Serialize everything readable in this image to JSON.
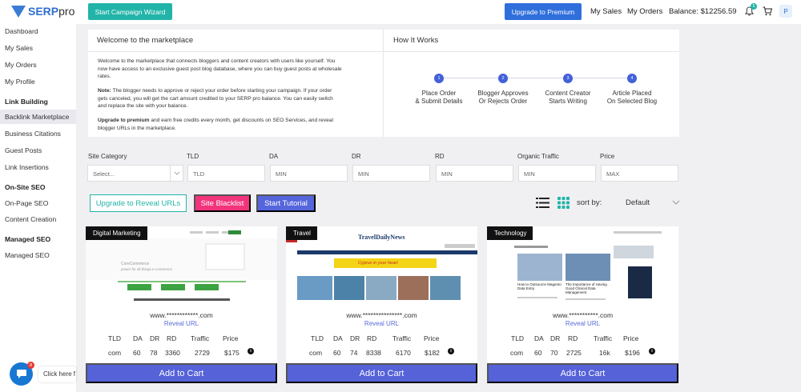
{
  "header": {
    "logo_prefix": "SERP",
    "logo_suffix": "pro",
    "wizard_label": "Start Campaign Wizard",
    "upgrade_label": "Upgrade to Premium",
    "my_sales": "My Sales",
    "my_orders": "My Orders",
    "balance": "Balance: $12256.59",
    "notification_count": "5",
    "avatar_initial": "P",
    "accent_color": "#22b4a8",
    "primary_color": "#2f6fdc"
  },
  "sidebar": {
    "items": [
      "Dashboard",
      "My Sales",
      "My Orders",
      "My Profile"
    ],
    "link_building_heading": "Link Building",
    "link_building_items": [
      "Backlink Marketplace",
      "Business Citations",
      "Guest Posts",
      "Link Insertions"
    ],
    "onsite_heading": "On-Site SEO",
    "onsite_items": [
      "On-Page SEO",
      "Content Creation"
    ],
    "managed_heading": "Managed SEO",
    "managed_items": [
      "Managed SEO"
    ],
    "active_item": "Backlink Marketplace"
  },
  "welcome": {
    "title": "Welcome to the marketplace",
    "intro": "Welcome to the marketplace that connects bloggers and content creators with users like yourself. You now have access to an exclusive guest post blog database, where you can buy guest posts at wholesale rates.",
    "note_label": "Note:",
    "note_text": " The blogger needs to approve or reject your order before starting your campaign. If your order gets canceled, you will get the cart amount credited to your SERP pro balance. You can easily switch and replace the site with your balance.",
    "premium_label": "Upgrade to premium",
    "premium_text": " and earn free credits every month, get discounts on SEO Services, and reveal blogger URLs in the marketplace."
  },
  "how_it_works": {
    "title": "How It Works",
    "steps": [
      {
        "num": "1",
        "line1": "Place Order",
        "line2": "& Submit Details"
      },
      {
        "num": "2",
        "line1": "Blogger Approves",
        "line2": "Or Rejects Order"
      },
      {
        "num": "3",
        "line1": "Content Creator",
        "line2": "Starts Writing"
      },
      {
        "num": "4",
        "line1": "Article Placed",
        "line2": "On Selected Blog"
      }
    ]
  },
  "filters": {
    "site_category": {
      "label": "Site Category",
      "placeholder": "Select..."
    },
    "tld": {
      "label": "TLD",
      "placeholder": "TLD"
    },
    "da": {
      "label": "DA",
      "placeholder": "MIN"
    },
    "dr": {
      "label": "DR",
      "placeholder": "MIN"
    },
    "rd": {
      "label": "RD",
      "placeholder": "MIN"
    },
    "traffic": {
      "label": "Organic Traffic",
      "placeholder": "MIN"
    },
    "price": {
      "label": "Price",
      "placeholder": "MAX"
    }
  },
  "actions": {
    "reveal_urls": "Upgrade to Reveal URLs",
    "blacklist": "Site Blacklist",
    "tutorial": "Start Tutorial",
    "sort_label": "sort by:",
    "sort_value": "Default"
  },
  "metric_headers": [
    "TLD",
    "DA",
    "DR",
    "RD",
    "Traffic",
    "Price"
  ],
  "cards": [
    {
      "category": "Digital Marketing",
      "url": "www.************.com",
      "reveal": "Reveal URL",
      "tld": "com",
      "da": "60",
      "dr": "78",
      "rd": "3360",
      "traffic": "2729",
      "price": "$175",
      "cta": "Add to Cart"
    },
    {
      "category": "Travel",
      "url": "www.***************.com",
      "reveal": "Reveal URL",
      "tld": "com",
      "da": "60",
      "dr": "74",
      "rd": "8338",
      "traffic": "6170",
      "price": "$182",
      "cta": "Add to Cart"
    },
    {
      "category": "Technology",
      "url": "www.***********.com",
      "reveal": "Reveal URL",
      "tld": "com",
      "da": "60",
      "dr": "70",
      "rd": "2725",
      "traffic": "16k",
      "price": "$196",
      "cta": "Add to Cart"
    }
  ],
  "thumbs": {
    "card1_brand": "CoreCommerce",
    "card1_tagline": "power for all things e-commerce",
    "card2_masthead": "TravelDailyNews",
    "card2_banner": "Cyprus in your heart",
    "card3_caption1": "How to Outsource Magento Data Entry",
    "card3_caption2": "The Importance of Having Good Clinical Data Management"
  },
  "chat": {
    "badge": "8",
    "text": "Click here f"
  }
}
